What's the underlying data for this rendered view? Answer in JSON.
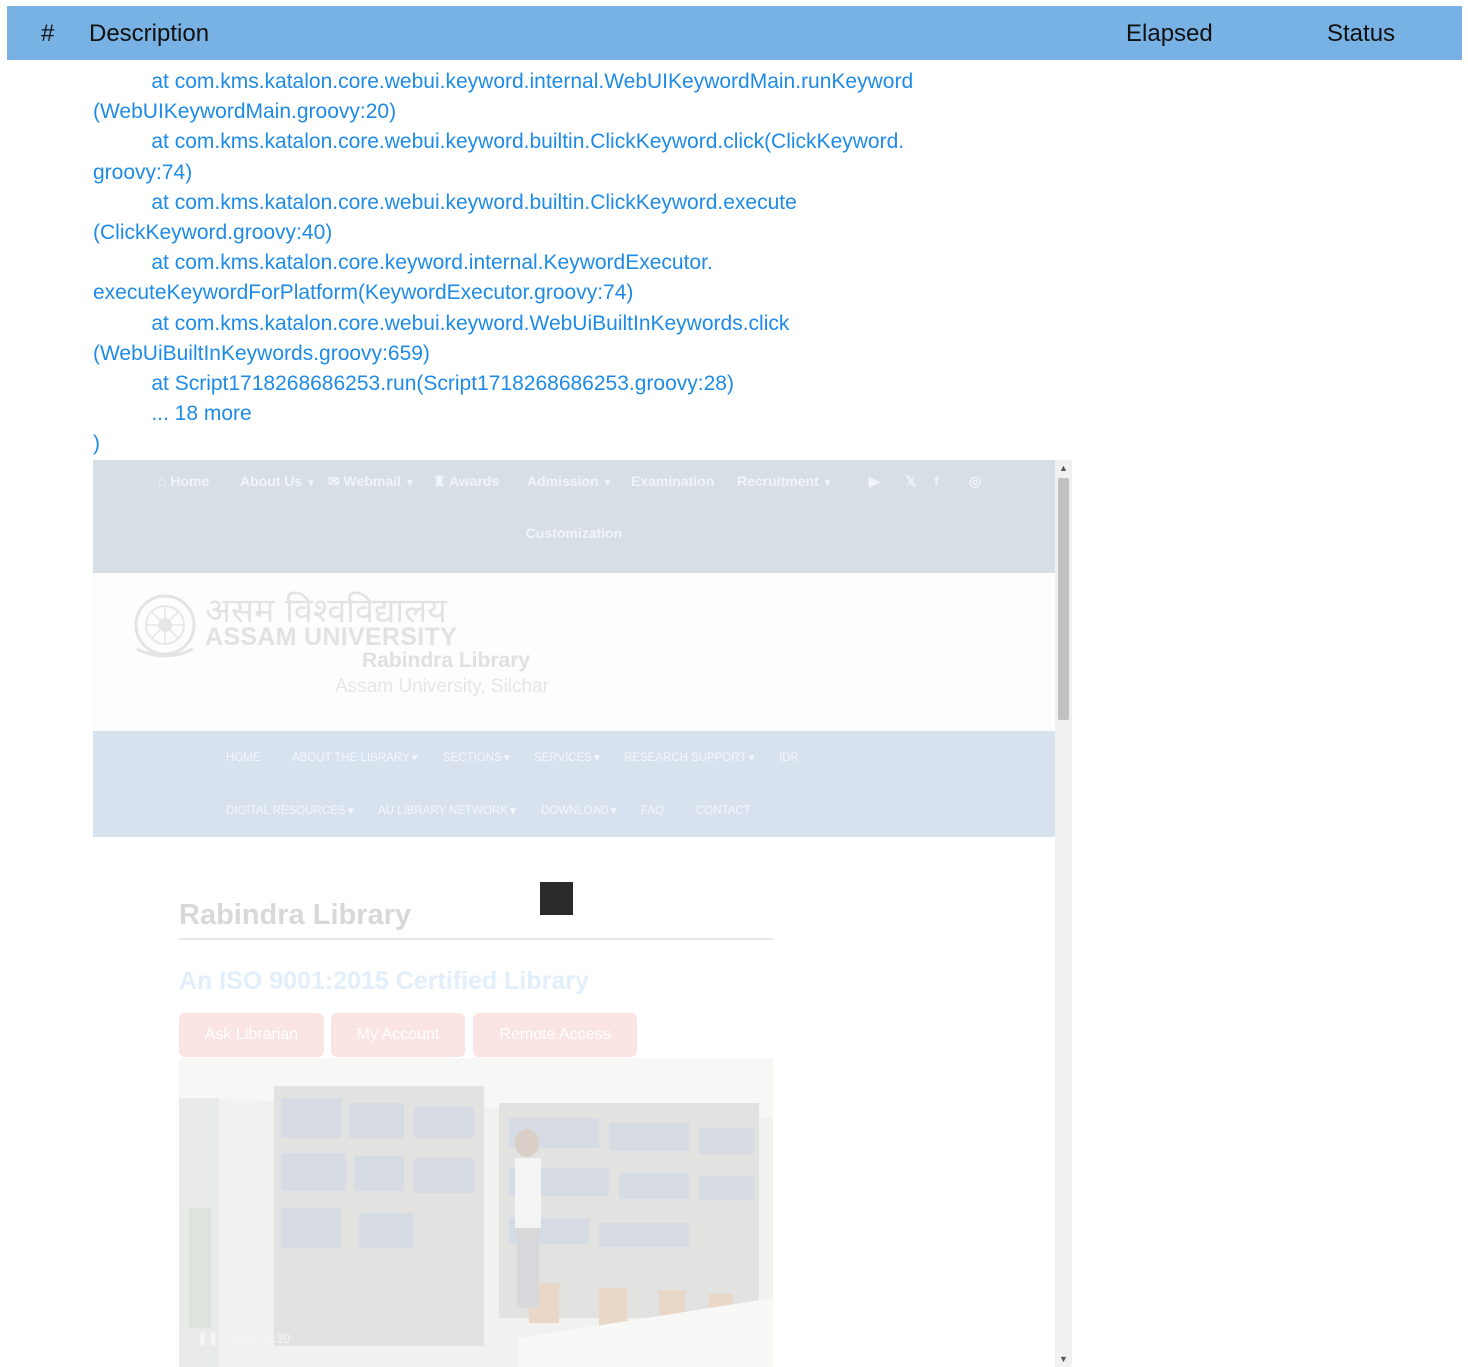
{
  "header": {
    "num_label": "#",
    "description_label": "Description",
    "elapsed_label": "Elapsed",
    "status_label": "Status"
  },
  "stack_trace": [
    "          at com.kms.katalon.core.webui.keyword.internal.WebUIKeywordMain.runKeyword",
    "(WebUIKeywordMain.groovy:20)",
    "          at com.kms.katalon.core.webui.keyword.builtin.ClickKeyword.click(ClickKeyword.",
    "groovy:74)",
    "          at com.kms.katalon.core.webui.keyword.builtin.ClickKeyword.execute",
    "(ClickKeyword.groovy:40)",
    "          at com.kms.katalon.core.keyword.internal.KeywordExecutor.",
    "executeKeywordForPlatform(KeywordExecutor.groovy:74)",
    "          at com.kms.katalon.core.webui.keyword.WebUiBuiltInKeywords.click",
    "(WebUiBuiltInKeywords.groovy:659)",
    "          at Script1718268686253.run(Script1718268686253.groovy:28)",
    "          ... 18 more",
    ")"
  ],
  "screenshot": {
    "top_nav": {
      "home": "Home",
      "about": "About Us",
      "webmail": "Webmail",
      "awards": "Awards",
      "admission": "Admission",
      "examination": "Examination",
      "recruitment": "Recruitment",
      "customization": "Customization"
    },
    "brand": {
      "hindi": "असम विश्वविद्यालय",
      "university": "ASSAM UNIVERSITY",
      "library": "Rabindra Library",
      "location": "Assam University, Silchar"
    },
    "main_nav": {
      "home": "HOME",
      "about_library": "ABOUT THE LIBRARY",
      "sections": "SECTIONS",
      "services": "SERVICES",
      "research_support": "RESEARCH SUPPORT",
      "idr": "IDR",
      "digital_resources": "DIGITAL RESOURCES",
      "au_network": "AU LIBRARY NETWORK",
      "download": "DOWNLOAD",
      "faq": "FAQ",
      "contact": "CONTACT"
    },
    "content": {
      "title": "Rabindra Library",
      "iso": "An ISO 9001:2015 Certified Library",
      "buttons": {
        "ask": "Ask Librarian",
        "account": "My Account",
        "remote": "Remote Access"
      },
      "video_time": "0:00 / 0:39"
    }
  }
}
